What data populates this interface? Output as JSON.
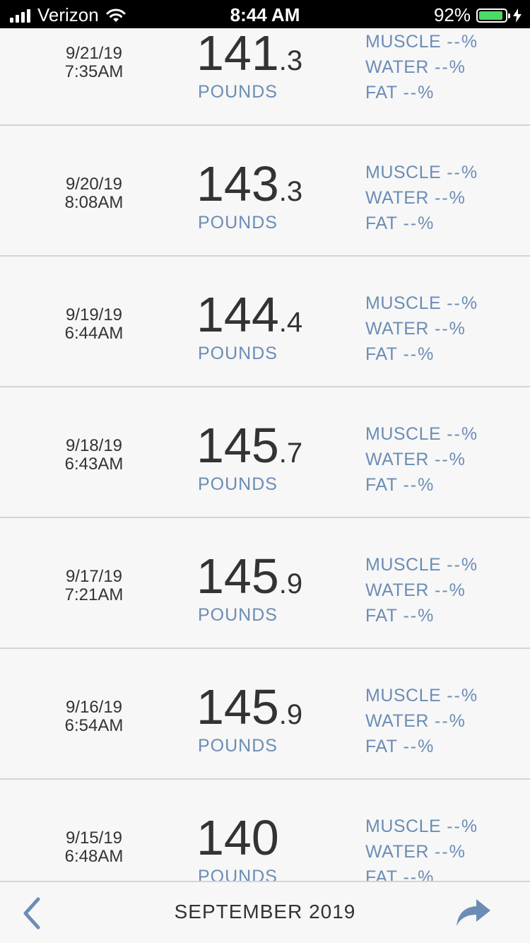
{
  "status_bar": {
    "carrier": "Verizon",
    "time": "8:44 AM",
    "battery": "92%",
    "battery_level": 0.92
  },
  "entries": [
    {
      "date": "9/21/19",
      "time": "7:35AM",
      "weight_int": "141",
      "weight_dec": ".3",
      "unit": "POUNDS",
      "muscle_label": "MUSCLE",
      "muscle": "--%",
      "water_label": "WATER",
      "water": "--%",
      "fat_label": "FAT",
      "fat": "--%"
    },
    {
      "date": "9/20/19",
      "time": "8:08AM",
      "weight_int": "143",
      "weight_dec": ".3",
      "unit": "POUNDS",
      "muscle_label": "MUSCLE",
      "muscle": "--%",
      "water_label": "WATER",
      "water": "--%",
      "fat_label": "FAT",
      "fat": "--%"
    },
    {
      "date": "9/19/19",
      "time": "6:44AM",
      "weight_int": "144",
      "weight_dec": ".4",
      "unit": "POUNDS",
      "muscle_label": "MUSCLE",
      "muscle": "--%",
      "water_label": "WATER",
      "water": "--%",
      "fat_label": "FAT",
      "fat": "--%"
    },
    {
      "date": "9/18/19",
      "time": "6:43AM",
      "weight_int": "145",
      "weight_dec": ".7",
      "unit": "POUNDS",
      "muscle_label": "MUSCLE",
      "muscle": "--%",
      "water_label": "WATER",
      "water": "--%",
      "fat_label": "FAT",
      "fat": "--%"
    },
    {
      "date": "9/17/19",
      "time": "7:21AM",
      "weight_int": "145",
      "weight_dec": ".9",
      "unit": "POUNDS",
      "muscle_label": "MUSCLE",
      "muscle": "--%",
      "water_label": "WATER",
      "water": "--%",
      "fat_label": "FAT",
      "fat": "--%"
    },
    {
      "date": "9/16/19",
      "time": "6:54AM",
      "weight_int": "145",
      "weight_dec": ".9",
      "unit": "POUNDS",
      "muscle_label": "MUSCLE",
      "muscle": "--%",
      "water_label": "WATER",
      "water": "--%",
      "fat_label": "FAT",
      "fat": "--%"
    },
    {
      "date": "9/15/19",
      "time": "6:48AM",
      "weight_int": "140",
      "weight_dec": "",
      "unit": "POUNDS",
      "muscle_label": "MUSCLE",
      "muscle": "--%",
      "water_label": "WATER",
      "water": "--%",
      "fat_label": "FAT",
      "fat": "--%"
    }
  ],
  "footer": {
    "month": "SEPTEMBER 2019",
    "back_icon": "chevron-left-icon",
    "share_icon": "share-arrow-icon"
  },
  "colors": {
    "accent": "#6b8db5",
    "text": "#333333",
    "background": "#f7f7f7",
    "divider": "#d4d4d4",
    "battery": "#4cd964"
  }
}
